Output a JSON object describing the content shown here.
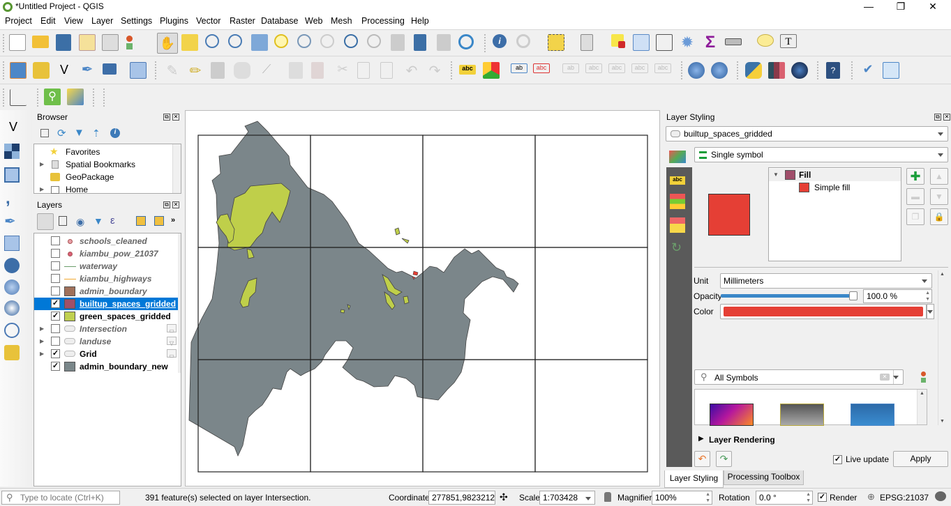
{
  "window": {
    "title": "*Untitled Project - QGIS",
    "minimize": "—",
    "restore": "❐",
    "close": "✕"
  },
  "menu": [
    "Project",
    "Edit",
    "View",
    "Layer",
    "Settings",
    "Plugins",
    "Vector",
    "Raster",
    "Database",
    "Web",
    "Mesh",
    "Processing",
    "Help"
  ],
  "toolbar1": [
    "new-project",
    "open-project",
    "save-project",
    "new-print-layout",
    "layout-manager",
    "style-manager",
    "pan-map",
    "pan-to-selection",
    "zoom-in",
    "zoom-out",
    "zoom-full",
    "zoom-to-selection",
    "zoom-to-layer",
    "zoom-native",
    "zoom-last",
    "zoom-next",
    "new-map-view",
    "new-bookmark",
    "show-bookmarks",
    "refresh",
    "identify",
    "run-action",
    "select-features",
    "select-by-value",
    "deselect-all",
    "open-attribute-table",
    "field-calculator",
    "processing-toolbox",
    "statistical-summary",
    "measure",
    "map-tips",
    "text-annotation"
  ],
  "toolbar2": [
    "data-source-manager",
    "new-geopackage-layer",
    "new-shapefile-layer",
    "new-spatialite-layer",
    "new-virtual-layer",
    "new-temporary-scratch-layer",
    "current-edits",
    "toggle-editing",
    "save-layer-edits",
    "add-polygon",
    "vertex-tool",
    "modify-attributes",
    "delete-selected",
    "cut-features",
    "copy-features",
    "paste-features",
    "undo",
    "redo",
    "layer-labeling",
    "layer-diagram",
    "highlight-pinned-labels",
    "pin-unpin-labels",
    "show-hide-labels",
    "preview-labels",
    "move-label",
    "rotate-label",
    "change-label",
    "metasearch",
    "metasearch-search",
    "python-console",
    "semi-automatic-classification",
    "qgis-earth",
    "help",
    "geometry-checker",
    "refresh-table"
  ],
  "toolbar3": [
    "profile-tool",
    "search-tool",
    "quickmapservices"
  ],
  "left_toolbar": [
    "add-vector-layer",
    "add-raster-layer",
    "add-mesh-layer",
    "add-delimited-text-layer",
    "add-spatialite-layer",
    "add-virtual-layer",
    "add-postgis-layer",
    "add-wms-layer",
    "add-wcs-layer",
    "add-wfs-layer",
    "add-geopackage-layer"
  ],
  "browser": {
    "title": "Browser",
    "items": [
      {
        "label": "Favorites",
        "icon": "star-icon",
        "expandable": false
      },
      {
        "label": "Spatial Bookmarks",
        "icon": "bookmark-icon",
        "expandable": true
      },
      {
        "label": "GeoPackage",
        "icon": "geopackage-icon",
        "expandable": false
      },
      {
        "label": "Home",
        "icon": "home-folder-icon",
        "expandable": true
      }
    ]
  },
  "layers": {
    "title": "Layers",
    "items": [
      {
        "name": "schools_cleaned",
        "checked": false,
        "italic": true,
        "symbol": "point",
        "color": "#e8a0a8",
        "expandable": false,
        "indicator": ""
      },
      {
        "name": "kiambu_pow_21037",
        "checked": false,
        "italic": true,
        "symbol": "point",
        "color": "#d95f77",
        "expandable": false,
        "indicator": ""
      },
      {
        "name": "waterway",
        "checked": false,
        "italic": true,
        "symbol": "line",
        "color": "#6b9e6b",
        "expandable": false,
        "indicator": ""
      },
      {
        "name": "kiambu_highways",
        "checked": false,
        "italic": true,
        "symbol": "line",
        "color": "#f0a830",
        "expandable": false,
        "indicator": ""
      },
      {
        "name": "admin_boundary",
        "checked": false,
        "italic": true,
        "symbol": "fill",
        "color": "#a0705a",
        "expandable": false,
        "indicator": ""
      },
      {
        "name": "builtup_spaces_gridded",
        "checked": true,
        "italic": false,
        "symbol": "fill",
        "color": "#a05068",
        "expandable": false,
        "selected": true,
        "indicator": ""
      },
      {
        "name": "green_spaces_gridded",
        "checked": true,
        "italic": false,
        "symbol": "fill",
        "color": "#c0d050",
        "expandable": false,
        "indicator": ""
      },
      {
        "name": "Intersection",
        "checked": false,
        "italic": true,
        "symbol": "group",
        "color": "#ccc",
        "expandable": true,
        "indicator": "memory-layer-icon"
      },
      {
        "name": "landuse",
        "checked": false,
        "italic": true,
        "symbol": "group",
        "color": "#ccc",
        "expandable": true,
        "indicator": "filter-icon"
      },
      {
        "name": "Grid",
        "checked": true,
        "italic": false,
        "symbol": "group",
        "color": "#ccc",
        "expandable": true,
        "indicator": "memory-layer-icon"
      },
      {
        "name": "admin_boundary_new",
        "checked": true,
        "italic": false,
        "symbol": "fill",
        "color": "#7a878a",
        "expandable": false,
        "indicator": ""
      }
    ]
  },
  "styling": {
    "title": "Layer Styling",
    "layer": "builtup_spaces_gridded",
    "renderer": "Single symbol",
    "symbol_tree": {
      "root": "Fill",
      "root_color": "#a04e6a",
      "child": "Simple fill",
      "child_color": "#e53f35"
    },
    "preview_color": "#e53f35",
    "unit_label": "Unit",
    "unit": "Millimeters",
    "opacity_label": "Opacity",
    "opacity": "100.0 %",
    "opacity_fraction": 1.0,
    "color_label": "Color",
    "color": "#e53f35",
    "search_placeholder": "All Symbols",
    "layer_rendering": "Layer Rendering",
    "live_update": "Live update",
    "live_update_checked": true,
    "apply": "Apply",
    "tabs": [
      "Layer Styling",
      "Processing Toolbox"
    ]
  },
  "map": {
    "background": "#ffffff",
    "admin_fill": "#7b868a",
    "green_fill": "#bfcf4a",
    "builtup_fill": "#e53f35",
    "grid_cols": 4,
    "grid_rows": 3
  },
  "status": {
    "locate_placeholder": "Type to locate (Ctrl+K)",
    "message": "391 feature(s) selected on layer Intersection.",
    "coordinate_label": "Coordinate",
    "coordinate": "277851,9823212",
    "scale_label": "Scale",
    "scale": "1:703428",
    "magnifier_label": "Magnifier",
    "magnifier": "100%",
    "rotation_label": "Rotation",
    "rotation": "0.0 °",
    "render_label": "Render",
    "render_checked": true,
    "crs": "EPSG:21037"
  }
}
